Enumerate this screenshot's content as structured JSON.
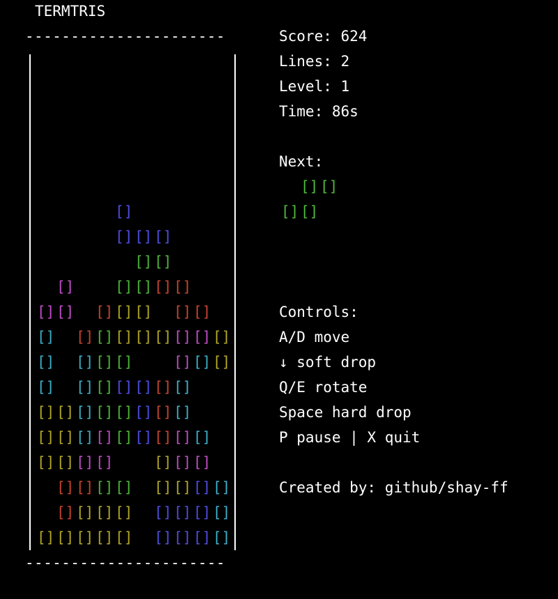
{
  "title": "TERMTRIS",
  "border_line": "----------------------",
  "block_glyph": "[]",
  "colors": {
    "background": "#000000",
    "text": "#ffffff",
    "R": "#c8442f",
    "Y": "#b5a928",
    "G": "#4fb83a",
    "B": "#4f4ee0",
    "M": "#c24ec8",
    "C": "#3fb0c8"
  },
  "board": {
    "columns": 10,
    "rows": [
      "..........",
      "..........",
      "..........",
      "..........",
      "..........",
      "..........",
      "....B.....",
      "....BBB...",
      ".....GG...",
      ".M..GGRR..",
      "MM.RYY.RR.",
      "C.RGYYYMMY",
      "C.CGG..MCY",
      "C.CGBBRC..",
      "YYCGGBRC..",
      "YYCMGBRMC.",
      "YYMM..YMM.",
      ".RRGG.YYBC",
      ".RYYY.BBBC",
      "YYYYY.BBBC"
    ]
  },
  "stats": {
    "score": "Score: 624",
    "lines": "Lines: 2",
    "level": "Level: 1",
    "time": "Time: 86s"
  },
  "next": {
    "label": "Next:",
    "color": "G",
    "shape": [
      ".GG",
      "GG."
    ]
  },
  "controls": {
    "label": "Controls:",
    "items": [
      "A/D move",
      "↓ soft drop",
      "Q/E rotate",
      "Space hard drop",
      "P pause | X quit"
    ]
  },
  "credit": "Created by: github/shay-ff"
}
